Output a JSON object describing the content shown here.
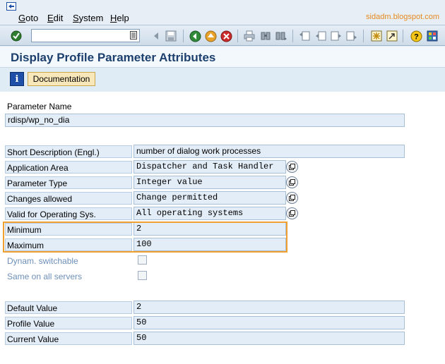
{
  "menu": {
    "items": [
      "Goto",
      "Edit",
      "System",
      "Help"
    ],
    "watermark": "sidadm.blogspot.com"
  },
  "toolbar": {
    "command_value": "",
    "icons": [
      "enter-icon",
      "save-icon",
      "back-icon",
      "exit-icon",
      "cancel-icon",
      "print-icon",
      "find-icon",
      "find-next-icon",
      "first-page-icon",
      "previous-page-icon",
      "next-page-icon",
      "last-page-icon",
      "create-session-icon",
      "shortcut-icon",
      "help-icon",
      "customize-layout-icon"
    ]
  },
  "page": {
    "title": "Display Profile Parameter Attributes",
    "documentation_button": "Documentation"
  },
  "form": {
    "parameter_name_label": "Parameter Name",
    "parameter_name_value": "rdisp/wp_no_dia",
    "short_description_label": "Short Description (Engl.)",
    "short_description_value": "number of dialog work processes",
    "application_area_label": "Application Area",
    "application_area_value": "Dispatcher and Task Handler",
    "parameter_type_label": "Parameter Type",
    "parameter_type_value": "Integer value",
    "changes_allowed_label": "Changes allowed",
    "changes_allowed_value": "Change permitted",
    "valid_os_label": "Valid for Operating Sys.",
    "valid_os_value": "All operating systems",
    "minimum_label": "Minimum",
    "minimum_value": "2",
    "maximum_label": "Maximum",
    "maximum_value": "100",
    "dynamic_label": "Dynam. switchable",
    "dynamic_checked": false,
    "same_servers_label": "Same on all servers",
    "same_servers_checked": false,
    "default_value_label": "Default Value",
    "default_value": "2",
    "profile_value_label": "Profile Value",
    "profile_value": "50",
    "current_value_label": "Current Value",
    "current_value": "50"
  },
  "colors": {
    "highlight": "#f0a030",
    "title": "#1c3f6e",
    "field_bg": "#e3edf7",
    "disabled_label": "#6d8fb8"
  }
}
